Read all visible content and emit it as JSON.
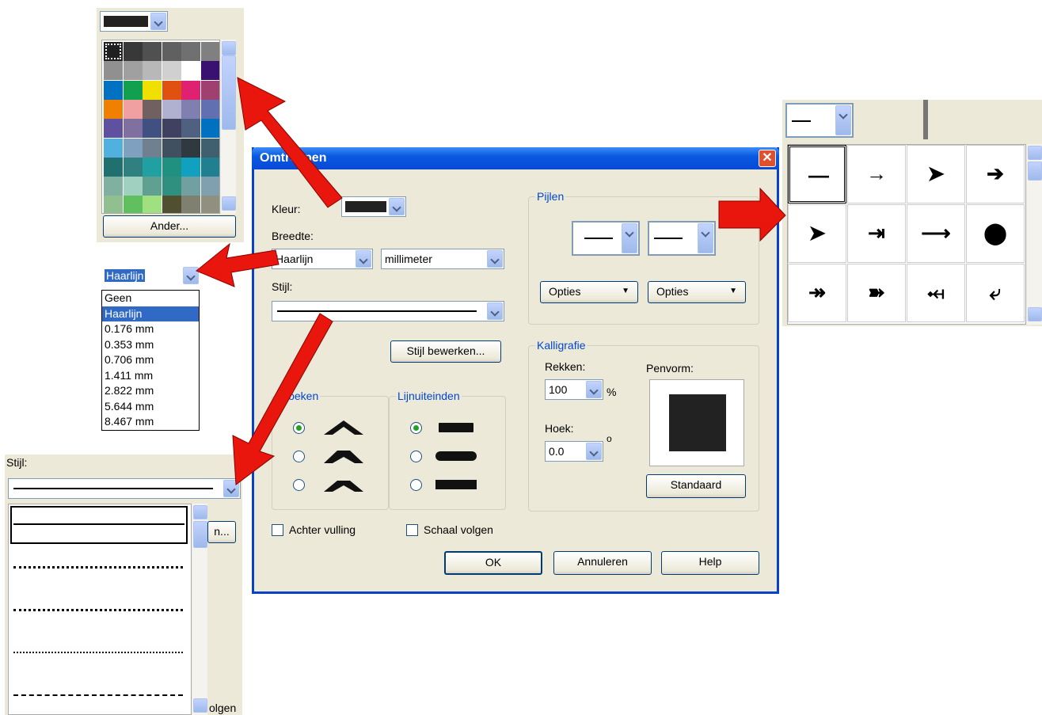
{
  "dialog": {
    "title": "Omtrekpen",
    "labels": {
      "color": "Kleur:",
      "width": "Breedte:",
      "style": "Stijl:"
    },
    "width_value": "Haarlijn",
    "unit_value": "millimeter",
    "edit_style": "Stijl bewerken...",
    "corners_group": "Hoeken",
    "caps_group": "Lijnuiteinden",
    "arrows_group": "Pijlen",
    "options_1": "Opties",
    "options_2": "Opties",
    "calli_group": "Kalligrafie",
    "stretch_label": "Rekken:",
    "stretch_value": "100",
    "stretch_unit": "%",
    "angle_label": "Hoek:",
    "angle_value": "0.0",
    "angle_unit": "o",
    "nib_label": "Penvorm:",
    "default_btn": "Standaard",
    "behind_fill": "Achter vulling",
    "scale_with": "Schaal volgen",
    "ok": "OK",
    "cancel": "Annuleren",
    "help": "Help"
  },
  "color_popup": {
    "other_btn": "Ander...",
    "colors": [
      "#202020",
      "#383838",
      "#505050",
      "#606060",
      "#707070",
      "#808080",
      "#909090",
      "#a0a0a0",
      "#b8b8b8",
      "#d0d0d0",
      "#ffffff",
      "#3a1070",
      "#0070c0",
      "#10a050",
      "#f0e000",
      "#e05010",
      "#e02070",
      "#a04070",
      "#f08000",
      "#f0a0a0",
      "#706060",
      "#b0b0d0",
      "#8080b0",
      "#6070b0",
      "#6050a0",
      "#8070a0",
      "#405080",
      "#404060",
      "#506080",
      "#0070c0",
      "#50b0e0",
      "#80a0c0",
      "#708090",
      "#405060",
      "#303840",
      "#406070",
      "#207070",
      "#308080",
      "#20a0a0",
      "#209080",
      "#10a0c0",
      "#208090",
      "#80b0a0",
      "#a0d0c0",
      "#60a090",
      "#309080",
      "#70a0a0",
      "#80a0b0",
      "#90c090",
      "#60c060",
      "#a0e080",
      "#505030",
      "#808070",
      "#909080"
    ]
  },
  "width_list": [
    "Geen",
    "Haarlijn",
    "0.176 mm",
    "0.353 mm",
    "0.706 mm",
    "1.411 mm",
    "2.822 mm",
    "5.644 mm",
    "8.467 mm"
  ],
  "width_combo_value": "Haarlijn",
  "style_popup": {
    "label": "Stijl:",
    "partial_btn": "n...",
    "partial_text": "olgen"
  },
  "arrow_popup": {
    "cells": [
      "—",
      "→",
      "➤",
      "➔",
      "➤",
      "⇥",
      "⟶",
      "⬤",
      "↠",
      "➽",
      "⤟",
      "⤶"
    ]
  }
}
